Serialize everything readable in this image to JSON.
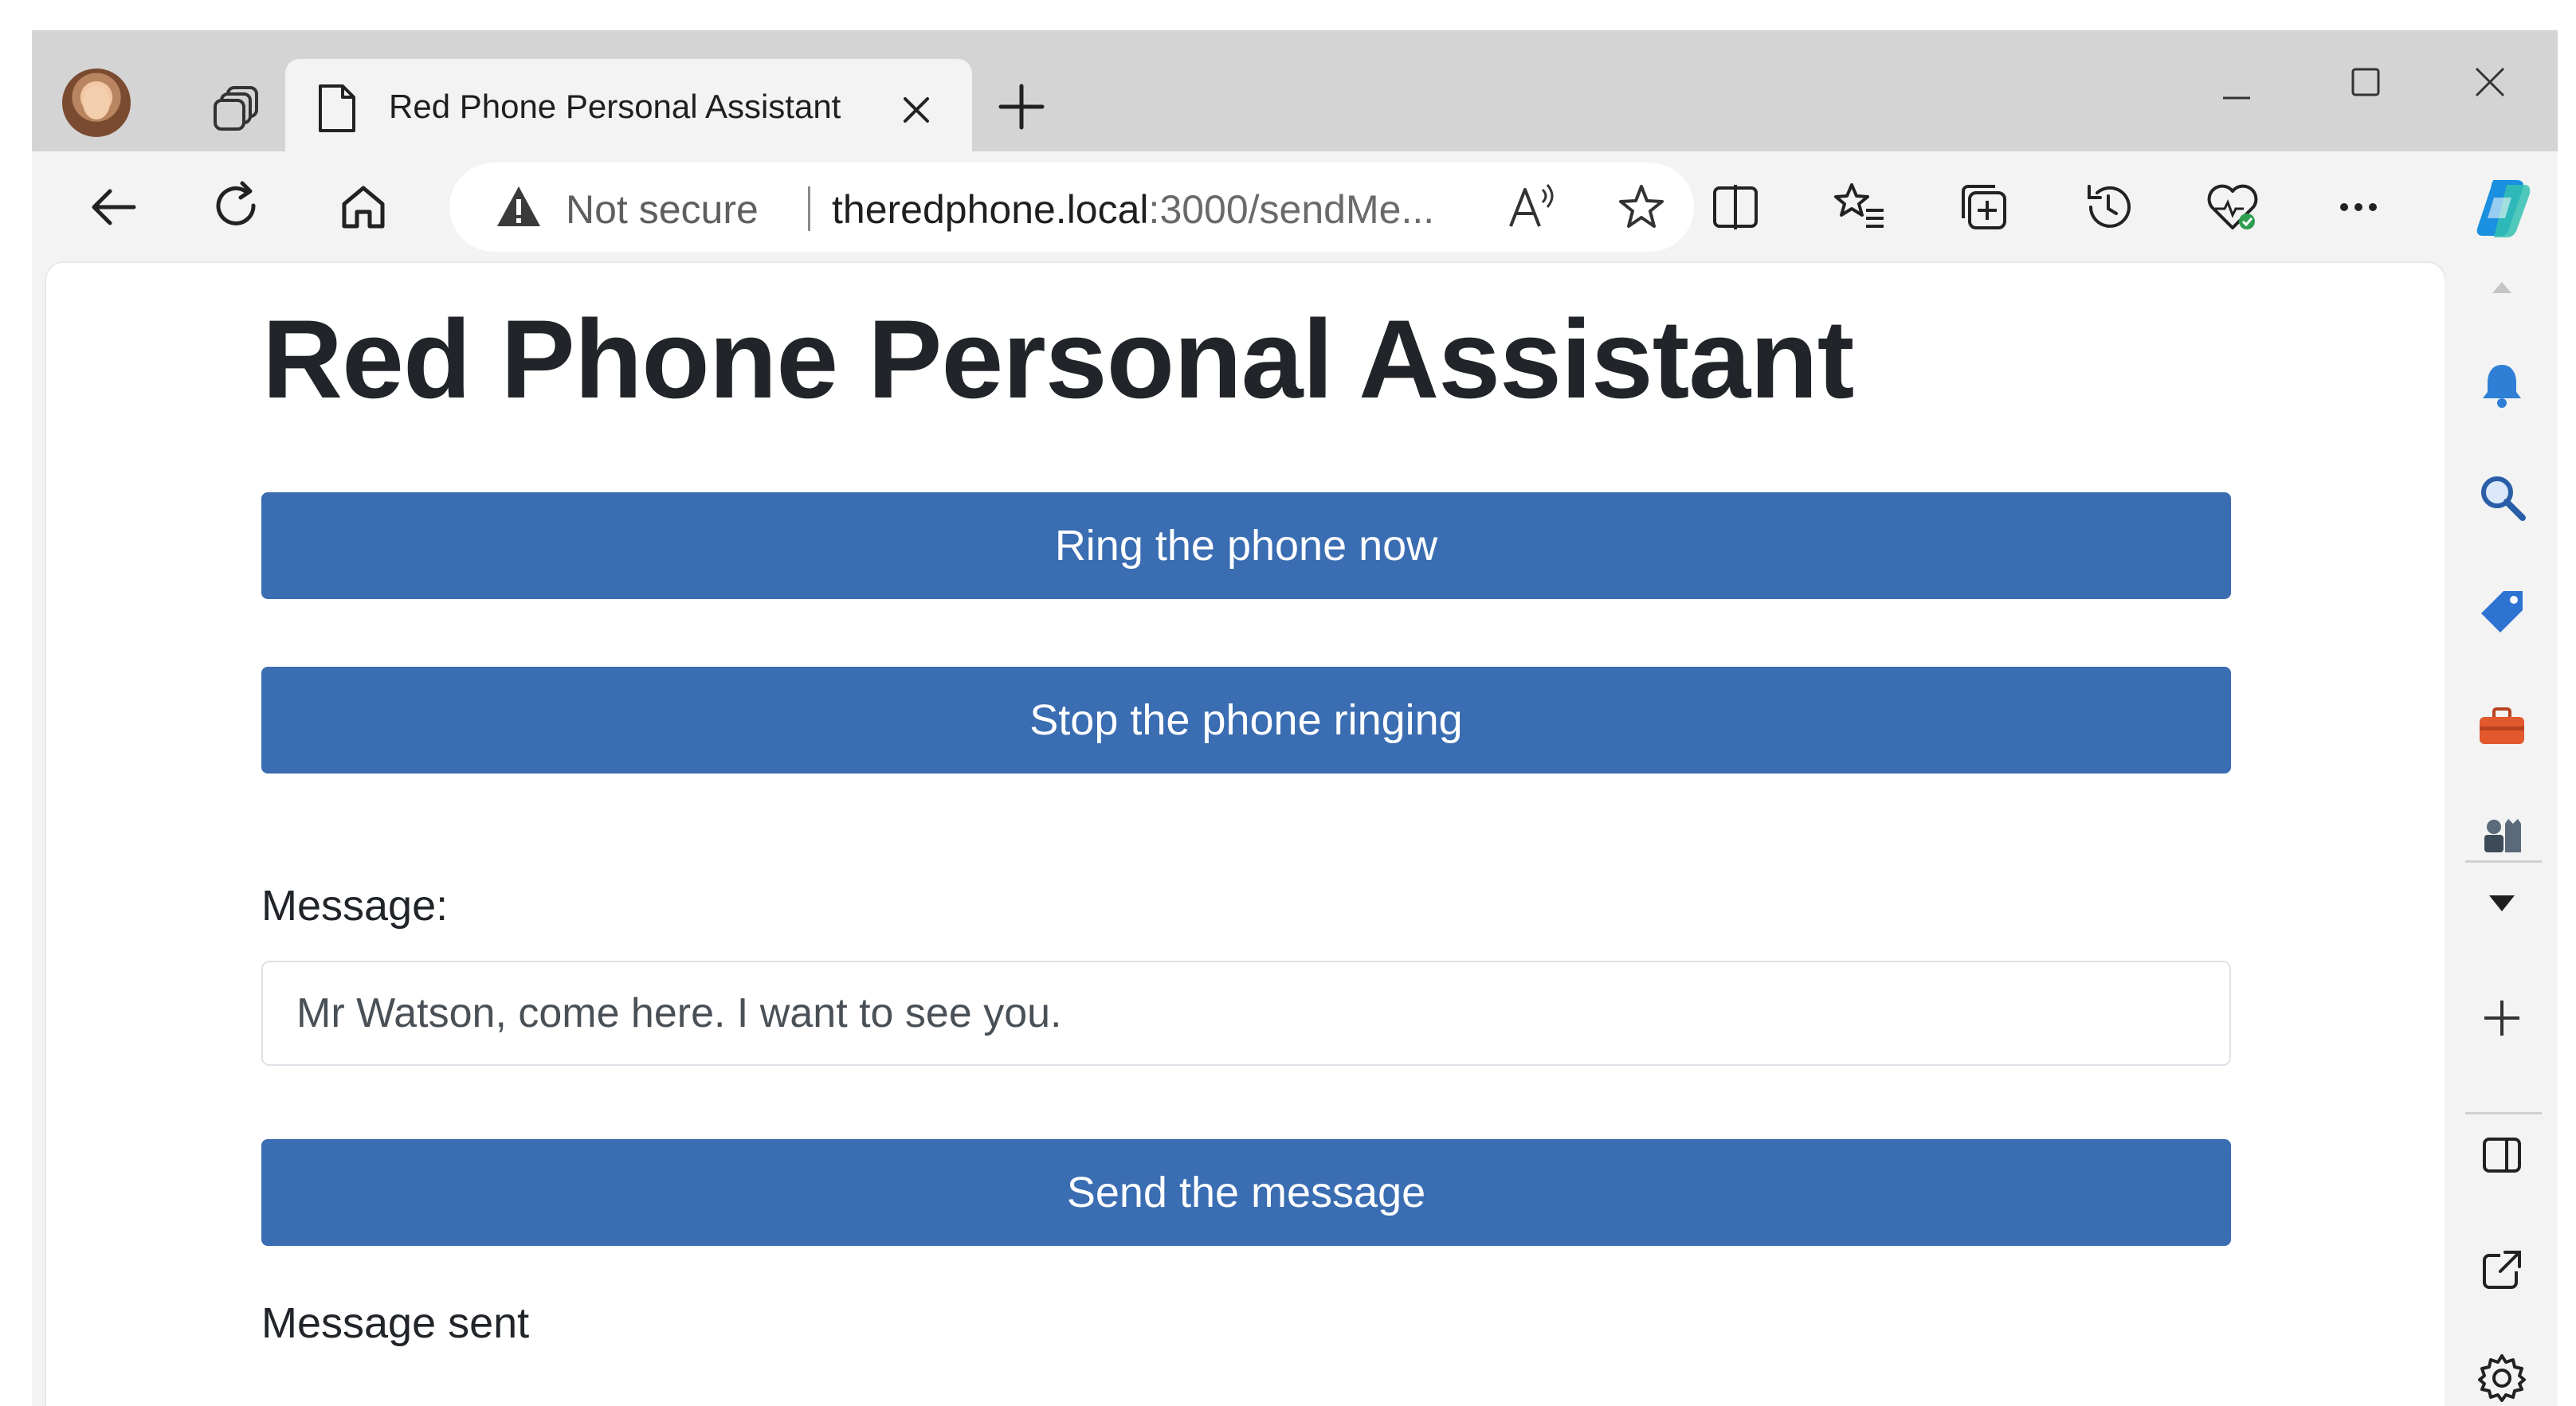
{
  "tab": {
    "title": "Red Phone Personal Assistant"
  },
  "addressbar": {
    "security_label": "Not secure",
    "url_host": "theredphone.local",
    "url_path": ":3000/sendMe..."
  },
  "page": {
    "title": "Red Phone Personal Assistant",
    "ring_button_label": "Ring the phone now",
    "stop_button_label": "Stop the phone ringing",
    "message_label": "Message:",
    "message_value": "Mr Watson, come here. I want to see you.",
    "send_button_label": "Send the message",
    "status_text": "Message sent"
  },
  "colors": {
    "button": "#3a6db2",
    "tabstrip": "#d4d4d4",
    "toolbar": "#f3f3f3"
  },
  "icons": {
    "tabstrip": [
      "profile-avatar",
      "tab-actions-icon",
      "page-icon",
      "close-icon",
      "plus-icon",
      "minimize-icon",
      "maximize-icon",
      "close-window-icon"
    ],
    "toolbar": [
      "back-arrow-icon",
      "refresh-icon",
      "home-icon",
      "warning-icon",
      "read-aloud-icon",
      "star-icon",
      "split-screen-icon",
      "favorites-icon",
      "collections-icon",
      "history-icon",
      "browser-essentials-icon",
      "more-icon",
      "copilot-icon"
    ],
    "sidebar": [
      "scroll-up-icon",
      "bell-icon",
      "search-icon",
      "tag-icon",
      "toolbox-icon",
      "games-icon",
      "chevron-down-icon",
      "add-icon",
      "sidebar-toggle-icon",
      "open-external-icon",
      "settings-icon"
    ]
  }
}
